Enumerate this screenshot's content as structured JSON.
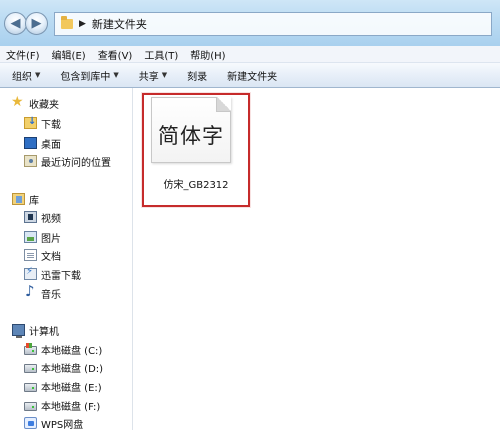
{
  "address": {
    "path": "新建文件夹"
  },
  "menu": [
    "文件(F)",
    "编辑(E)",
    "查看(V)",
    "工具(T)",
    "帮助(H)"
  ],
  "toolbar": [
    {
      "label": "组织",
      "dropdown": true
    },
    {
      "label": "包含到库中",
      "dropdown": true
    },
    {
      "label": "共享",
      "dropdown": true
    },
    {
      "label": "刻录",
      "dropdown": false
    },
    {
      "label": "新建文件夹",
      "dropdown": false
    }
  ],
  "navigation": {
    "favorites": {
      "label": "收藏夹",
      "items": [
        "下载",
        "桌面",
        "最近访问的位置"
      ]
    },
    "libraries": {
      "label": "库",
      "items": [
        "视频",
        "图片",
        "文档",
        "迅雷下载",
        "音乐"
      ]
    },
    "computer": {
      "label": "计算机",
      "items": [
        "本地磁盘 (C:)",
        "本地磁盘 (D:)",
        "本地磁盘 (E:)",
        "本地磁盘 (F:)",
        "WPS网盘"
      ]
    }
  },
  "files": [
    {
      "name": "仿宋_GB2312",
      "preview": "简体字",
      "selected": true,
      "icon": "font-file-icon"
    }
  ],
  "colors": {
    "selection_border": "#c62b2b",
    "folder": "#f2c85d"
  }
}
